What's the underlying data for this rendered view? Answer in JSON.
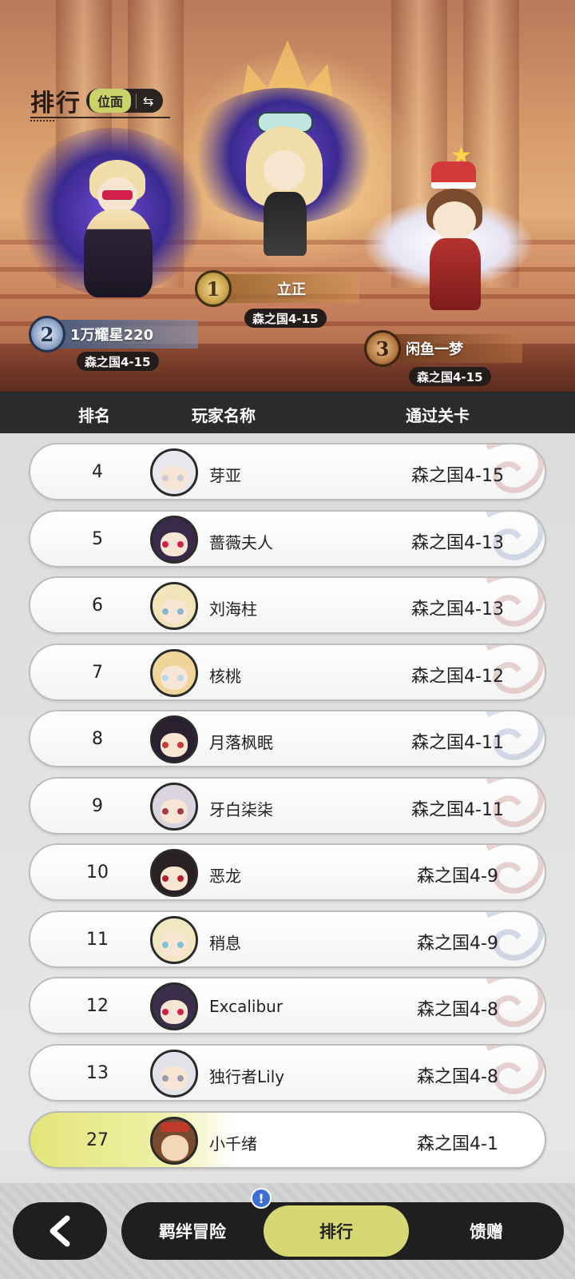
{
  "header": {
    "title": "排行",
    "mode_label": "位面",
    "swap_icon": "⇆"
  },
  "podium": {
    "first": {
      "rank": "1",
      "name": "立正",
      "stage": "森之国4-15"
    },
    "second": {
      "rank": "2",
      "name": "1万耀星220",
      "stage": "森之国4-15"
    },
    "third": {
      "rank": "3",
      "name": "闲鱼一梦",
      "stage": "森之国4-15"
    }
  },
  "columns": {
    "rank": "排名",
    "player": "玩家名称",
    "stage": "通过关卡"
  },
  "rows": [
    {
      "rank": "4",
      "name": "芽亚",
      "stage": "森之国4-15"
    },
    {
      "rank": "5",
      "name": "蔷薇夫人",
      "stage": "森之国4-13"
    },
    {
      "rank": "6",
      "name": "刘海柱",
      "stage": "森之国4-13"
    },
    {
      "rank": "7",
      "name": "核桃",
      "stage": "森之国4-12"
    },
    {
      "rank": "8",
      "name": "月落枫眠",
      "stage": "森之国4-11"
    },
    {
      "rank": "9",
      "name": "牙白柒柒",
      "stage": "森之国4-11"
    },
    {
      "rank": "10",
      "name": "恶龙",
      "stage": "森之国4-9"
    },
    {
      "rank": "11",
      "name": "稍息",
      "stage": "森之国4-9"
    },
    {
      "rank": "12",
      "name": "Excalibur",
      "stage": "森之国4-8"
    },
    {
      "rank": "13",
      "name": "独行者Lily",
      "stage": "森之国4-8"
    }
  ],
  "my_row": {
    "rank": "27",
    "name": "小千绪",
    "stage": "森之国4-1"
  },
  "nav": {
    "back_icon": "chevron-left",
    "tabs": [
      {
        "label": "羁绊冒险"
      },
      {
        "label": "排行"
      },
      {
        "label": "馈赠"
      }
    ],
    "notification": "!"
  },
  "colors": {
    "accent": "#d7d874",
    "dark": "#1f1f1f",
    "header_bar": "#2b2b2b",
    "notif": "#3b6fd6"
  }
}
